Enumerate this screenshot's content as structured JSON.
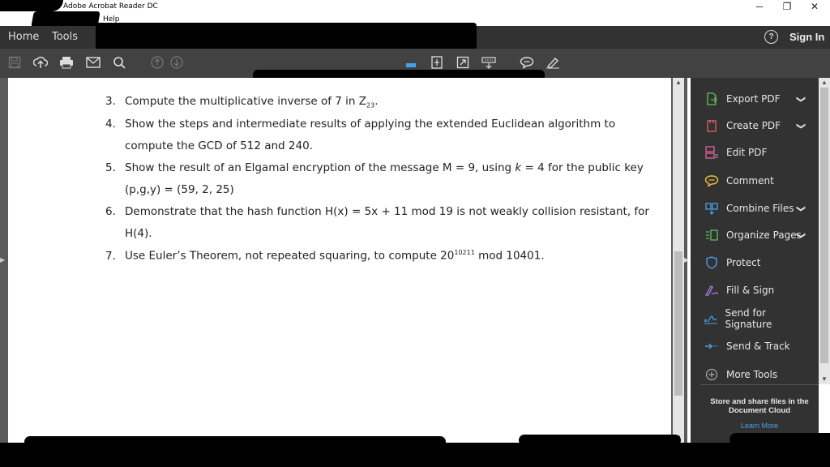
{
  "window": {
    "title": "Adobe Acrobat Reader DC",
    "menu_help": "Help",
    "minimize": "─",
    "restore": "❐",
    "close": "✕"
  },
  "nav": {
    "home": "Home",
    "tools": "Tools",
    "help_icon": "?",
    "signin": "Sign In"
  },
  "toolbar": {
    "icons": [
      "save-icon",
      "upload-icon",
      "print-icon",
      "email-icon",
      "search-icon",
      "prev-page-icon",
      "next-page-icon",
      "select-icon",
      "fit-page-icon",
      "fullscreen-icon",
      "keyboard-icon",
      "comment-icon",
      "pen-icon"
    ]
  },
  "document": {
    "items": [
      {
        "num": "3.",
        "pre": "Compute the multiplicative inverse of 7 in Z",
        "sub": "23",
        "post": "."
      },
      {
        "num": "4.",
        "text": "Show the steps and intermediate results of applying the extended Euclidean algorithm to",
        "cont": "compute the GCD of 512 and 240."
      },
      {
        "num": "5.",
        "text_a": "Show the result of an Elgamal encryption of the message M = 9, using ",
        "k": "k",
        "text_b": " = 4 for the public key",
        "cont": "(p,g,y) = (59, 2, 25)"
      },
      {
        "num": "6.",
        "text": "Demonstrate that the hash function H(x) = 5x + 11 mod 19 is not weakly collision resistant, for",
        "cont": "H(4)."
      },
      {
        "num": "7.",
        "pre": "Use Euler’s Theorem, not repeated squaring, to compute 20",
        "sup": "10211",
        "post": " mod 10401."
      }
    ]
  },
  "right_panel": {
    "items": [
      {
        "label": "Export PDF",
        "icon": "export-pdf-icon",
        "color": "#5fbf5f",
        "chevron": true
      },
      {
        "label": "Create PDF",
        "icon": "create-pdf-icon",
        "color": "#e06060",
        "chevron": true
      },
      {
        "label": "Edit PDF",
        "icon": "edit-pdf-icon",
        "color": "#e0609a",
        "chevron": false
      },
      {
        "label": "Comment",
        "icon": "comment-icon",
        "color": "#f0c040",
        "chevron": false
      },
      {
        "label": "Combine Files",
        "icon": "combine-files-icon",
        "color": "#4aa0e8",
        "chevron": true
      },
      {
        "label": "Organize Pages",
        "icon": "organize-pages-icon",
        "color": "#5fbf5f",
        "chevron": true
      },
      {
        "label": "Protect",
        "icon": "protect-icon",
        "color": "#4aa0e8",
        "chevron": false
      },
      {
        "label": "Fill & Sign",
        "icon": "fill-sign-icon",
        "color": "#b07ae0",
        "chevron": false
      },
      {
        "label": "Send for Signature",
        "icon": "send-signature-icon",
        "color": "#4aa0e8",
        "chevron": false
      },
      {
        "label": "Send & Track",
        "icon": "send-track-icon",
        "color": "#4aa0e8",
        "chevron": false
      },
      {
        "label": "More Tools",
        "icon": "more-tools-icon",
        "color": "#aaaaaa",
        "chevron": false
      }
    ],
    "store_text": "Store and share files in the Document Cloud",
    "learn_more": "Learn More"
  }
}
